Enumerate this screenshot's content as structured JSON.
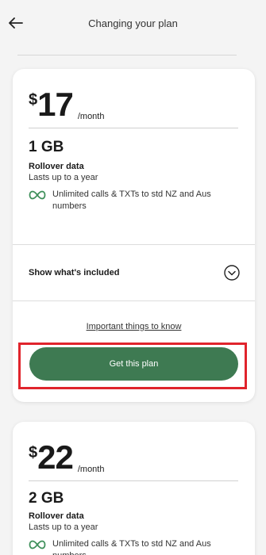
{
  "header": {
    "title": "Changing your plan"
  },
  "plans": [
    {
      "currency_symbol": "$",
      "price": "17",
      "price_unit": "/month",
      "data_amount": "1 GB",
      "data_type": "Rollover data",
      "rollover_note": "Lasts up to a year",
      "feature": "Unlimited calls & TXTs to std NZ and Aus numbers",
      "show_included_label": "Show what's included",
      "important_link": "Important things to know",
      "cta_label": "Get this plan"
    },
    {
      "currency_symbol": "$",
      "price": "22",
      "price_unit": "/month",
      "data_amount": "2 GB",
      "data_type": "Rollover data",
      "rollover_note": "Lasts up to a year",
      "feature": "Unlimited calls & TXTs to std NZ and Aus numbers"
    }
  ],
  "colors": {
    "brand_green": "#3e7a52",
    "icon_green": "#3e8f5a",
    "highlight_red": "#e0242c"
  }
}
